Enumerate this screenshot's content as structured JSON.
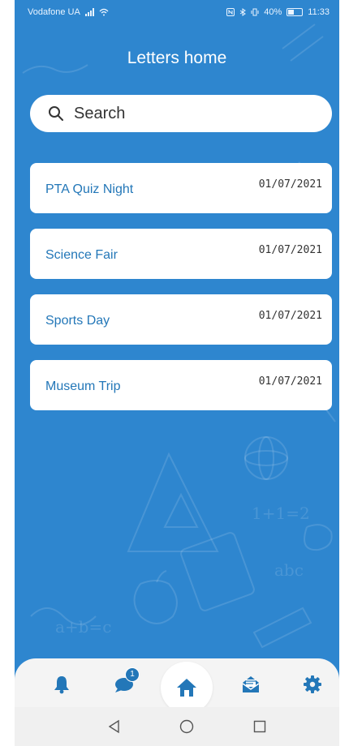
{
  "status_bar": {
    "carrier": "Vodafone UA",
    "right_text": "40%",
    "time": "11:33"
  },
  "header": {
    "title": "Letters home"
  },
  "search": {
    "placeholder": "Search",
    "value": ""
  },
  "letters": [
    {
      "title": "PTA Quiz Night",
      "date": "01/07/2021"
    },
    {
      "title": "Science Fair",
      "date": "01/07/2021"
    },
    {
      "title": "Sports Day",
      "date": "01/07/2021"
    },
    {
      "title": "Museum Trip",
      "date": "01/07/2021"
    }
  ],
  "bottom_nav": {
    "items": [
      {
        "icon": "bell-icon"
      },
      {
        "icon": "chat-icon",
        "badge": "1"
      },
      {
        "icon": "home-icon",
        "active": true
      },
      {
        "icon": "mail-icon"
      },
      {
        "icon": "gear-icon"
      }
    ]
  },
  "colors": {
    "background": "#2e86cf",
    "accent": "#2377b8",
    "card": "#ffffff",
    "nav_background": "#f4f4f4"
  }
}
